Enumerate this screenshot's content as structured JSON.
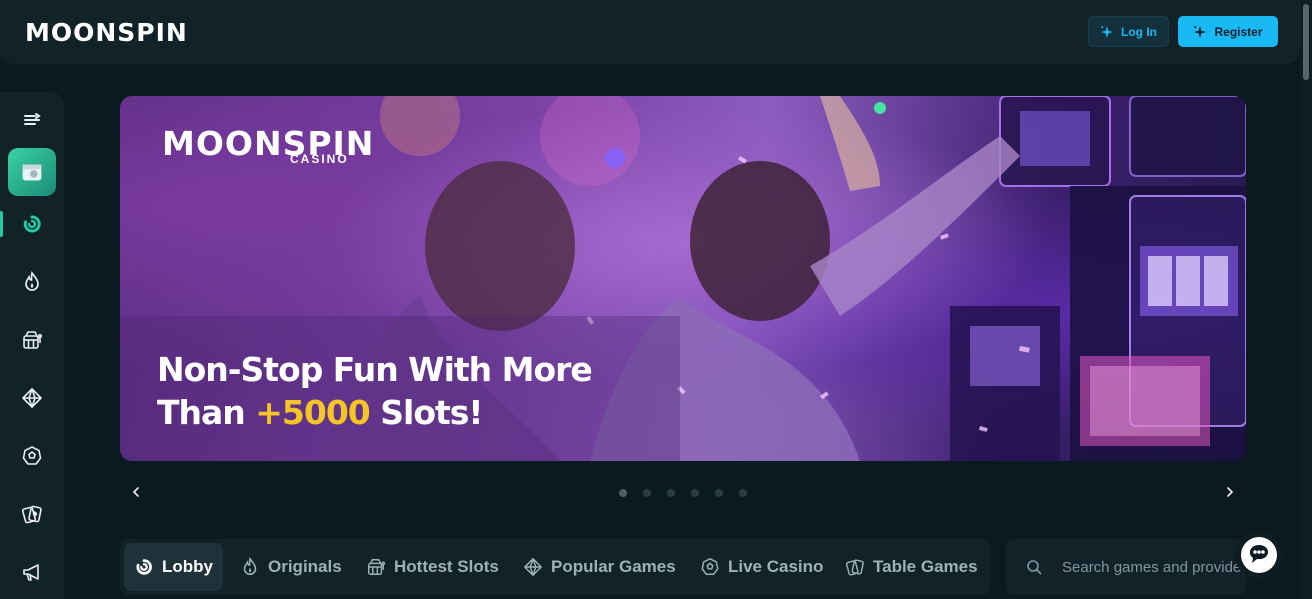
{
  "header": {
    "logo": "MOONSPIN",
    "login_label": "Log In",
    "register_label": "Register"
  },
  "sidebar": {
    "items": [
      {
        "icon": "menu-collapse-icon"
      },
      {
        "icon": "promo-gift-icon"
      },
      {
        "icon": "lobby-icon",
        "active": true
      },
      {
        "icon": "originals-flame-icon"
      },
      {
        "icon": "slots-icon"
      },
      {
        "icon": "diamond-icon"
      },
      {
        "icon": "live-casino-chip-icon"
      },
      {
        "icon": "table-games-cards-icon"
      },
      {
        "icon": "megaphone-icon"
      }
    ]
  },
  "banner": {
    "logo": "MOONSPIN",
    "logo_sub": "CASINO",
    "headline_line1": "Non-Stop Fun With More",
    "headline_line2_pre": "Than ",
    "headline_highlight": "+5000",
    "headline_line2_post": " Slots!"
  },
  "carousel": {
    "slide_count": 6,
    "active_index": 0
  },
  "tabs": [
    {
      "label": "Lobby",
      "icon": "lobby-icon",
      "active": true
    },
    {
      "label": "Originals",
      "icon": "originals-flame-icon"
    },
    {
      "label": "Hottest Slots",
      "icon": "slots-icon"
    },
    {
      "label": "Popular Games",
      "icon": "diamond-icon"
    },
    {
      "label": "Live Casino",
      "icon": "live-casino-chip-icon"
    },
    {
      "label": "Table Games",
      "icon": "table-games-cards-icon"
    }
  ],
  "search": {
    "placeholder": "Search games and providers",
    "value": ""
  },
  "colors": {
    "accent": "#19b9f4",
    "highlight": "#f6c425",
    "active_green": "#22c9a0"
  }
}
